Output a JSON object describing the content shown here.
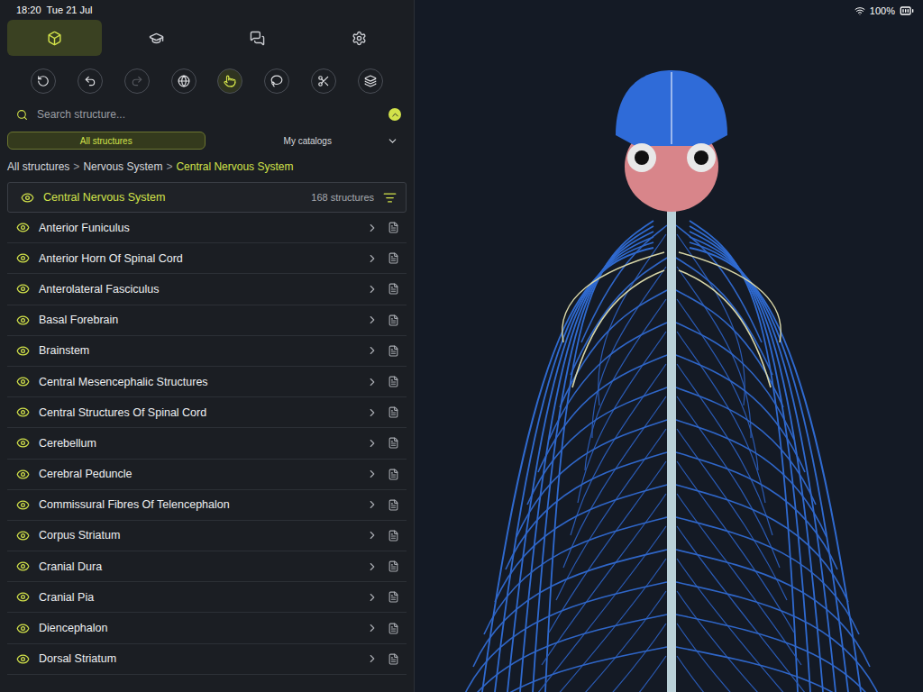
{
  "status_bar": {
    "time": "18:20",
    "date": "Tue 21 Jul",
    "battery": "100%",
    "battery_level": 1
  },
  "tabs": [
    {
      "selected": true
    },
    {
      "selected": false
    },
    {
      "selected": false
    },
    {
      "selected": false
    }
  ],
  "tools": [
    {
      "active": false,
      "disabled": false
    },
    {
      "active": false,
      "disabled": false
    },
    {
      "active": false,
      "disabled": true
    },
    {
      "active": false,
      "disabled": false
    },
    {
      "active": true,
      "disabled": false
    },
    {
      "active": false,
      "disabled": false
    },
    {
      "active": false,
      "disabled": false
    },
    {
      "active": false,
      "disabled": false
    }
  ],
  "search": {
    "placeholder": "Search structure..."
  },
  "filters": [
    {
      "label": "All structures",
      "selected": true
    },
    {
      "label": "My catalogs",
      "selected": false
    }
  ],
  "breadcrumb": {
    "separator": ">",
    "items": [
      {
        "label": "All structures",
        "current": false
      },
      {
        "label": "Nervous System",
        "current": false
      },
      {
        "label": "Central Nervous System",
        "current": true
      }
    ]
  },
  "group": {
    "name": "Central Nervous System",
    "count": "168 structures",
    "visible": true
  },
  "structures": [
    {
      "name": "Anterior Funiculus",
      "visible": true
    },
    {
      "name": "Anterior Horn Of Spinal Cord",
      "visible": true
    },
    {
      "name": "Anterolateral Fasciculus",
      "visible": true
    },
    {
      "name": "Basal Forebrain",
      "visible": true
    },
    {
      "name": "Brainstem",
      "visible": true
    },
    {
      "name": "Central Mesencephalic Structures",
      "visible": true
    },
    {
      "name": "Central Structures Of Spinal Cord",
      "visible": true
    },
    {
      "name": "Cerebellum",
      "visible": true
    },
    {
      "name": "Cerebral Peduncle",
      "visible": true
    },
    {
      "name": "Commissural Fibres Of Telencephalon",
      "visible": true
    },
    {
      "name": "Corpus Striatum",
      "visible": true
    },
    {
      "name": "Cranial Dura",
      "visible": true
    },
    {
      "name": "Cranial Pia",
      "visible": true
    },
    {
      "name": "Diencephalon",
      "visible": true
    },
    {
      "name": "Dorsal Striatum",
      "visible": true
    }
  ]
}
